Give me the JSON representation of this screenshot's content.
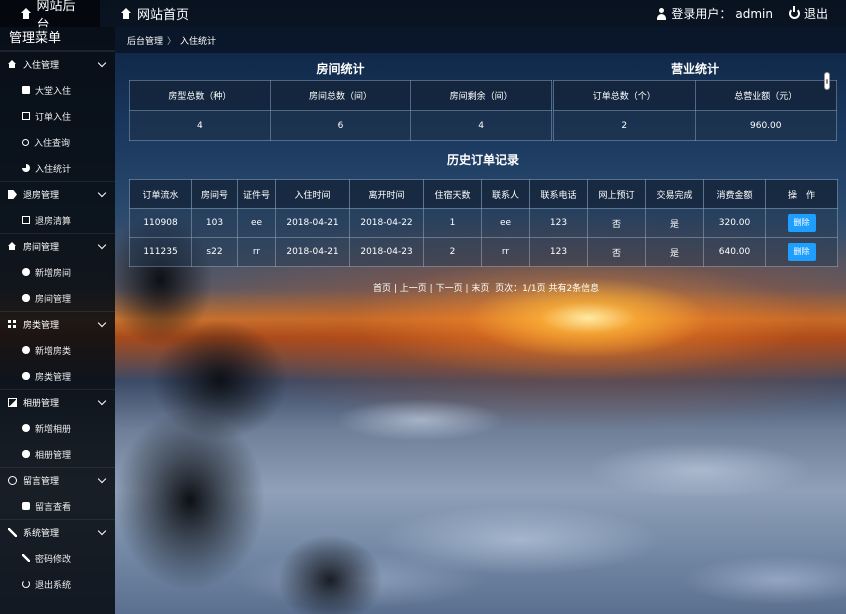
{
  "topbar": {
    "admin_tab": "网站后台",
    "home_tab": "网站首页",
    "user_label": "登录用户：",
    "username": "admin",
    "logout": "退出"
  },
  "sidebar": {
    "title": "管理菜单",
    "groups": [
      {
        "label": "入住管理",
        "icon": "house-icon",
        "items": [
          {
            "label": "大堂入住",
            "icon": "square-icon"
          },
          {
            "label": "订单入住",
            "icon": "book-icon"
          },
          {
            "label": "入住查询",
            "icon": "search-icon"
          },
          {
            "label": "入住统计",
            "icon": "pie-chart-icon"
          }
        ]
      },
      {
        "label": "退房管理",
        "icon": "tag-icon",
        "items": [
          {
            "label": "退房清算",
            "icon": "edit-icon"
          }
        ]
      },
      {
        "label": "房间管理",
        "icon": "house-icon",
        "items": [
          {
            "label": "新增房间",
            "icon": "plus-circle-icon"
          },
          {
            "label": "房间管理",
            "icon": "gear-icon"
          }
        ]
      },
      {
        "label": "房类管理",
        "icon": "grid-icon",
        "items": [
          {
            "label": "新增房类",
            "icon": "plus-circle-icon"
          },
          {
            "label": "房类管理",
            "icon": "gear-icon"
          }
        ]
      },
      {
        "label": "相册管理",
        "icon": "image-icon",
        "items": [
          {
            "label": "新增相册",
            "icon": "plus-circle-icon"
          },
          {
            "label": "相册管理",
            "icon": "gear-icon"
          }
        ]
      },
      {
        "label": "留言管理",
        "icon": "comment-icon",
        "items": [
          {
            "label": "留言查看",
            "icon": "chat-icon"
          }
        ]
      },
      {
        "label": "系统管理",
        "icon": "wrench-icon",
        "items": [
          {
            "label": "密码修改",
            "icon": "wrench-icon"
          },
          {
            "label": "退出系统",
            "icon": "power-icon"
          }
        ]
      }
    ]
  },
  "breadcrumb": {
    "root": "后台管理",
    "separator": "〉",
    "current": "入住统计"
  },
  "room_stats": {
    "title": "房间统计",
    "headers": [
      "房型总数（种）",
      "房间总数（间）",
      "房间剩余（间）"
    ],
    "values": [
      "4",
      "6",
      "4"
    ]
  },
  "business_stats": {
    "title": "营业统计",
    "headers": [
      "订单总数（个）",
      "总营业额（元）"
    ],
    "values": [
      "2",
      "960.00"
    ]
  },
  "orders": {
    "title": "历史订单记录",
    "headers": [
      "订单流水",
      "房间号",
      "证件号",
      "入住时间",
      "离开时间",
      "住宿天数",
      "联系人",
      "联系电话",
      "网上预订",
      "交易完成",
      "消费金额",
      "操　作"
    ],
    "rows": [
      [
        "110908",
        "103",
        "ee",
        "2018-04-21",
        "2018-04-22",
        "1",
        "ee",
        "123",
        "否",
        "是",
        "320.00"
      ],
      [
        "111235",
        "s22",
        "rr",
        "2018-04-21",
        "2018-04-23",
        "2",
        "rr",
        "123",
        "否",
        "是",
        "640.00"
      ]
    ],
    "delete_label": "删除"
  },
  "pager": {
    "first": "首页",
    "prev": "上一页",
    "next": "下一页",
    "last": "末页",
    "info": "页次：1/1页 共有2条信息"
  },
  "colors": {
    "accent": "#1e9fff"
  }
}
